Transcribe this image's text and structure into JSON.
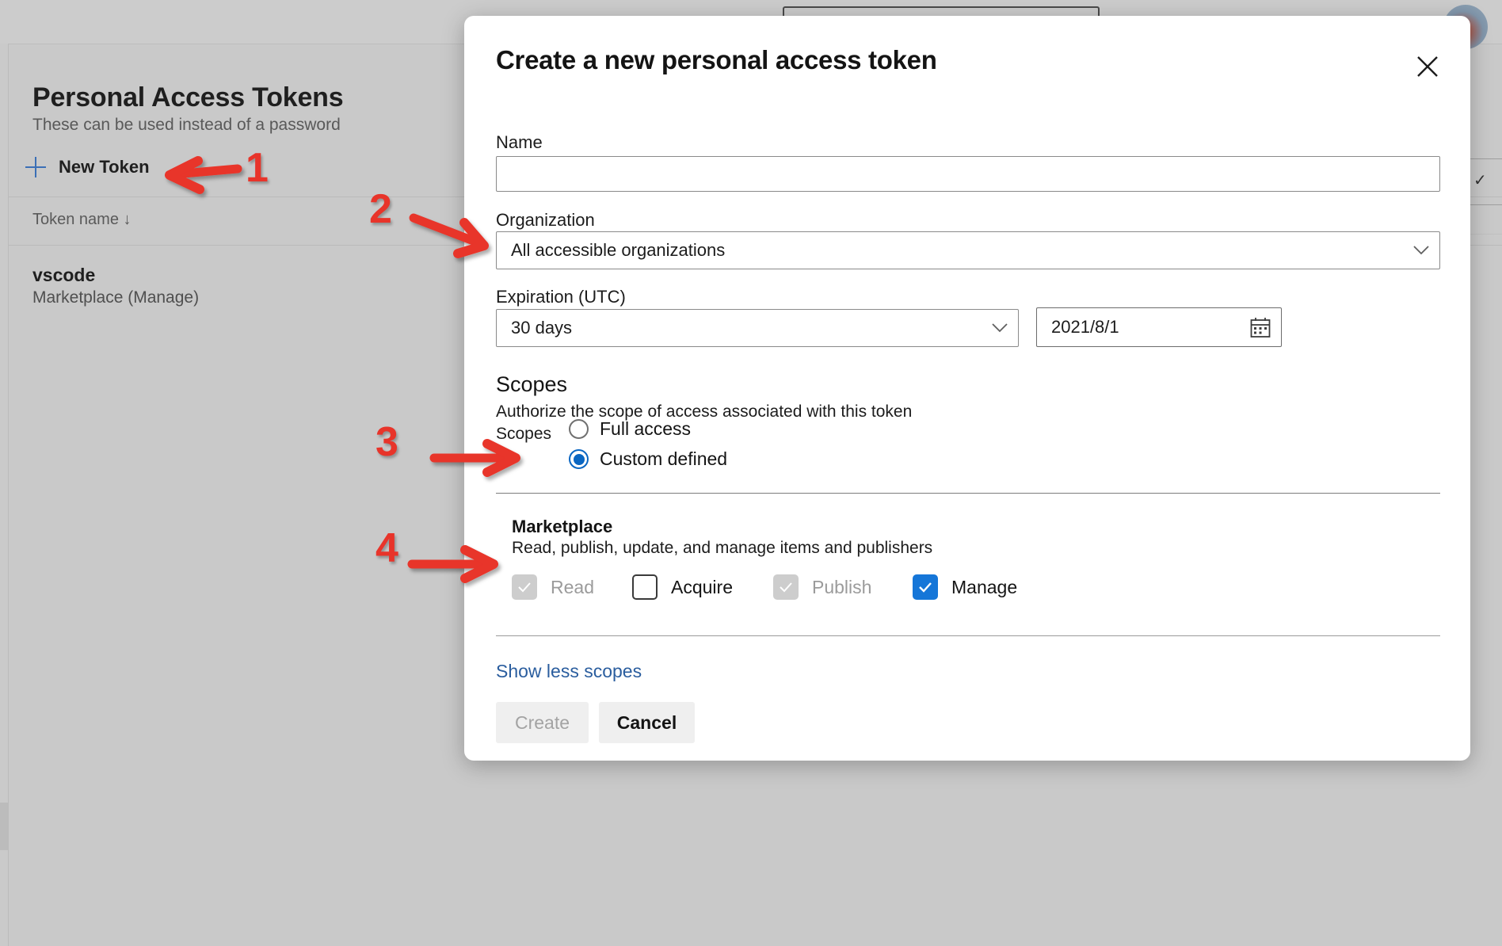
{
  "background": {
    "page_title": "Personal Access Tokens",
    "page_subtitle": "These can be used instead of a password",
    "new_token_label": "New Token",
    "new_token_icon": "plus-icon",
    "column_header": "Token name ↓",
    "token_row": {
      "name": "vscode",
      "scopes": "Marketplace (Manage)"
    },
    "search_placeholder": ""
  },
  "dialog": {
    "title": "Create a new personal access token",
    "close_icon": "close-icon",
    "name": {
      "label": "Name",
      "value": "",
      "placeholder": ""
    },
    "organization": {
      "label": "Organization",
      "selected": "All accessible organizations",
      "chevron_icon": "chevron-down-icon"
    },
    "expiration": {
      "label": "Expiration (UTC)",
      "preset_selected": "30 days",
      "preset_chevron_icon": "chevron-down-icon",
      "date_value": "2021/8/1",
      "calendar_icon": "calendar-icon"
    },
    "scopes": {
      "heading": "Scopes",
      "description": "Authorize the scope of access associated with this token",
      "group_label": "Scopes",
      "options": [
        {
          "label": "Full access",
          "selected": false
        },
        {
          "label": "Custom defined",
          "selected": true
        }
      ]
    },
    "marketplace": {
      "title": "Marketplace",
      "description": "Read, publish, update, and manage items and publishers",
      "permissions": [
        {
          "label": "Read",
          "state": "checked-disabled"
        },
        {
          "label": "Acquire",
          "state": "unchecked"
        },
        {
          "label": "Publish",
          "state": "checked-disabled"
        },
        {
          "label": "Manage",
          "state": "checked"
        }
      ]
    },
    "show_less_link": "Show less scopes",
    "buttons": {
      "create": "Create",
      "cancel": "Cancel"
    }
  },
  "annotations": {
    "steps": [
      {
        "number": "1"
      },
      {
        "number": "2"
      },
      {
        "number": "3"
      },
      {
        "number": "4"
      }
    ],
    "color": "#e8342a"
  }
}
